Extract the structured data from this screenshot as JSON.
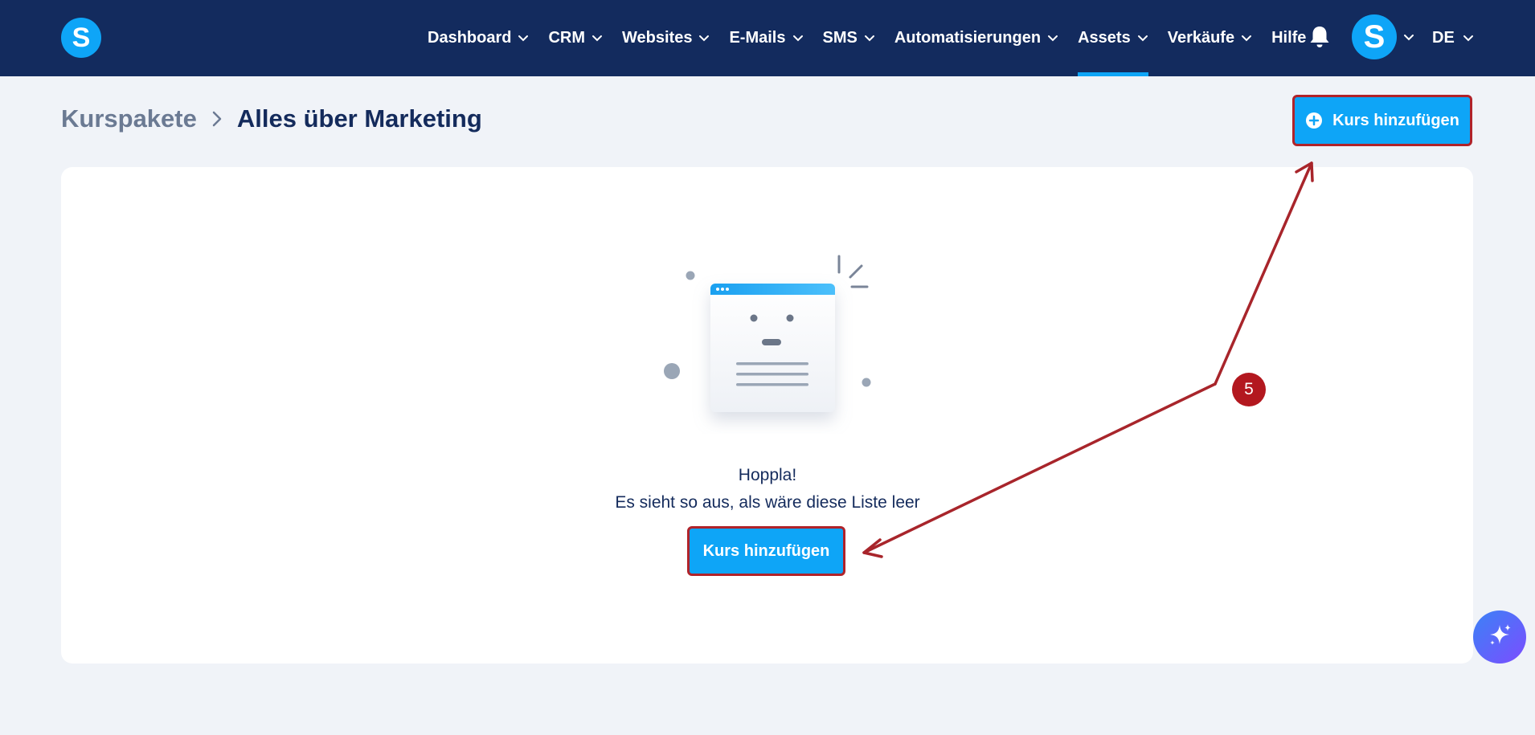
{
  "app": {
    "logo_letter": "S",
    "avatar_letter": "S"
  },
  "nav": {
    "items": [
      {
        "label": "Dashboard",
        "has_dropdown": true
      },
      {
        "label": "CRM",
        "has_dropdown": true
      },
      {
        "label": "Websites",
        "has_dropdown": true
      },
      {
        "label": "E-Mails",
        "has_dropdown": true
      },
      {
        "label": "SMS",
        "has_dropdown": true
      },
      {
        "label": "Automatisierungen",
        "has_dropdown": true
      },
      {
        "label": "Assets",
        "has_dropdown": true,
        "active": true
      },
      {
        "label": "Verkäufe",
        "has_dropdown": true
      },
      {
        "label": "Hilfe",
        "has_dropdown": false
      }
    ],
    "language": "DE"
  },
  "breadcrumb": {
    "parent": "Kurspakete",
    "current": "Alles über Marketing"
  },
  "header": {
    "add_button_label": "Kurs hinzufügen"
  },
  "empty_state": {
    "title": "Hoppla!",
    "subtitle": "Es sieht so aus, als wäre diese Liste leer",
    "button_label": "Kurs hinzufügen"
  },
  "annotation": {
    "step": "5"
  },
  "icons": {
    "bell": "bell-icon",
    "chevron": "chevron-down-icon",
    "plus": "plus-circle-icon",
    "fab": "sparkle-icon"
  },
  "colors": {
    "navbar": "#132b5e",
    "accent": "#0ea5f7",
    "annotation": "#b0232a",
    "background": "#f0f3f8"
  }
}
